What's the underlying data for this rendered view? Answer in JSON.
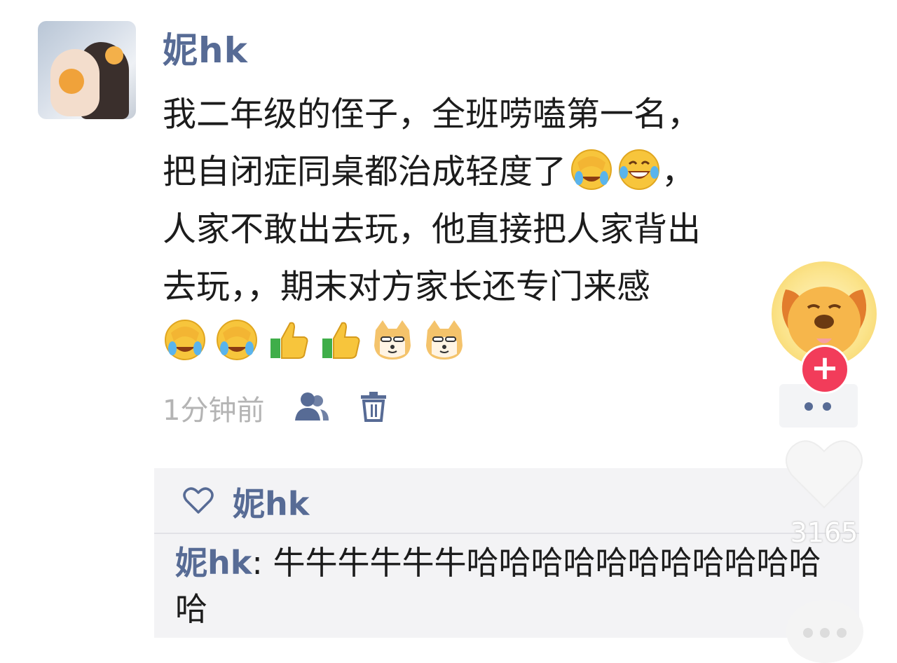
{
  "post": {
    "author": "妮hk",
    "text_lines": [
      "我二年级的侄子，全班唠嗑第一名，",
      "把自闭症同桌都治成轻度了",
      "人家不敢出去玩，他直接把人家背出",
      "去玩，，期末对方家长还专门来感"
    ],
    "line2_tail": "，",
    "inline_emojis": [
      "facepalm-cry-emoji",
      "laugh-cry-emoji"
    ],
    "emoji_row": [
      "facepalm-cry-emoji",
      "facepalm-cry-emoji",
      "thumbs-up-emoji",
      "thumbs-up-emoji",
      "doge-emoji",
      "doge-emoji"
    ],
    "timestamp": "1分钟前",
    "actions": [
      "contacts-icon",
      "trash-icon"
    ]
  },
  "likes": {
    "icon": "heart-outline-icon",
    "names": "妮hk"
  },
  "comments": [
    {
      "author": "妮hk",
      "separator": ": ",
      "text": "牛牛牛牛牛牛哈哈哈哈哈哈哈哈哈哈哈哈"
    }
  ],
  "overlay": {
    "like_count": "3165",
    "follow_symbol": "+",
    "icons": [
      "dog-avatar",
      "follow-plus-icon",
      "heart-icon",
      "more-dots-icon"
    ]
  },
  "colors": {
    "link_blue": "#576b95",
    "timestamp_gray": "#b4b4b4",
    "follow_red": "#f23c5a",
    "comment_bg": "#f3f3f5"
  }
}
